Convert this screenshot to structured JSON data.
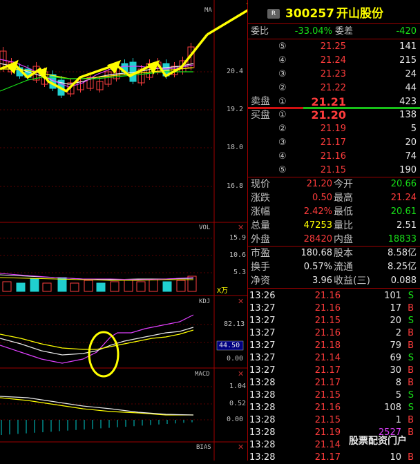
{
  "header": {
    "badge": "R",
    "code": "300257",
    "name": "开山股份"
  },
  "wb": {
    "wb_label": "委比",
    "wb_value": "-33.04%",
    "wc_label": "委差",
    "wc_value": "-420"
  },
  "asks": [
    {
      "level": "⑤",
      "price": "21.25",
      "vol": "141"
    },
    {
      "level": "④",
      "price": "21.24",
      "vol": "215"
    },
    {
      "level": "③",
      "price": "21.23",
      "vol": "24"
    },
    {
      "level": "②",
      "price": "21.22",
      "vol": "44"
    },
    {
      "level": "①",
      "price": "21.21",
      "vol": "423"
    }
  ],
  "bids": [
    {
      "level": "①",
      "price": "21.20",
      "vol": "138"
    },
    {
      "level": "②",
      "price": "21.19",
      "vol": "5"
    },
    {
      "level": "③",
      "price": "21.17",
      "vol": "20"
    },
    {
      "level": "④",
      "price": "21.16",
      "vol": "74"
    },
    {
      "level": "⑤",
      "price": "21.15",
      "vol": "190"
    }
  ],
  "sell_label": "卖盘",
  "buy_label": "买盘",
  "stats": [
    {
      "l1": "现价",
      "v1": "21.20",
      "l2": "今开",
      "v2": "20.66",
      "c1": "red",
      "c2": "green"
    },
    {
      "l1": "涨跌",
      "v1": "0.50",
      "l2": "最高",
      "v2": "21.24",
      "c1": "red",
      "c2": "red"
    },
    {
      "l1": "涨幅",
      "v1": "2.42%",
      "l2": "最低",
      "v2": "20.61",
      "c1": "red",
      "c2": "green"
    },
    {
      "l1": "总量",
      "v1": "47253",
      "l2": "量比",
      "v2": "2.51",
      "c1": "yellow",
      "c2": "white"
    },
    {
      "l1": "外盘",
      "v1": "28420",
      "l2": "内盘",
      "v2": "18833",
      "c1": "red",
      "c2": "green"
    }
  ],
  "finance": [
    {
      "l1": "市盈",
      "v1": "180.68",
      "l2": "股本",
      "v2": "8.58亿"
    },
    {
      "l1": "换手",
      "v1": "0.57%",
      "l2": "流通",
      "v2": "8.25亿"
    },
    {
      "l1": "净资",
      "v1": "3.96",
      "l2": "收益(三)",
      "v2": "0.088"
    }
  ],
  "ticks": [
    {
      "t": "13:26",
      "p": "21.16",
      "v": "101",
      "s": "S",
      "vc": "white"
    },
    {
      "t": "13:27",
      "p": "21.16",
      "v": "17",
      "s": "B",
      "vc": "white"
    },
    {
      "t": "13:27",
      "p": "21.15",
      "v": "20",
      "s": "S",
      "vc": "white"
    },
    {
      "t": "13:27",
      "p": "21.16",
      "v": "2",
      "s": "B",
      "vc": "white"
    },
    {
      "t": "13:27",
      "p": "21.18",
      "v": "79",
      "s": "B",
      "vc": "white"
    },
    {
      "t": "13:27",
      "p": "21.14",
      "v": "69",
      "s": "S",
      "vc": "white"
    },
    {
      "t": "13:27",
      "p": "21.17",
      "v": "30",
      "s": "B",
      "vc": "white"
    },
    {
      "t": "13:28",
      "p": "21.17",
      "v": "8",
      "s": "B",
      "vc": "white"
    },
    {
      "t": "13:28",
      "p": "21.15",
      "v": "5",
      "s": "S",
      "vc": "white"
    },
    {
      "t": "13:28",
      "p": "21.16",
      "v": "108",
      "s": "S",
      "vc": "white"
    },
    {
      "t": "13:28",
      "p": "21.15",
      "v": "1",
      "s": "B",
      "vc": "white"
    },
    {
      "t": "13:28",
      "p": "21.19",
      "v": "2527",
      "s": "B",
      "vc": "magenta"
    },
    {
      "t": "13:28",
      "p": "21.14",
      "v": "",
      "s": "",
      "vc": "white"
    },
    {
      "t": "13:28",
      "p": "21.17",
      "v": "10",
      "s": "B",
      "vc": "white"
    }
  ],
  "chart": {
    "ma_label": "MA",
    "price_ticks": [
      "20.4",
      "19.2",
      "18.0",
      "16.8"
    ],
    "vol_label": "VOL",
    "vol_ticks": [
      "15.9",
      "10.6",
      "5.3"
    ],
    "vol_unit": "X万",
    "kdj_label": "KDJ",
    "kdj_ticks": [
      "82.13",
      "44.50",
      "0.00"
    ],
    "macd_label": "MACD",
    "macd_ticks": [
      "1.04",
      "0.52",
      "0.00"
    ],
    "bias_label": "BIAS"
  },
  "watermark": "股票配资门户"
}
